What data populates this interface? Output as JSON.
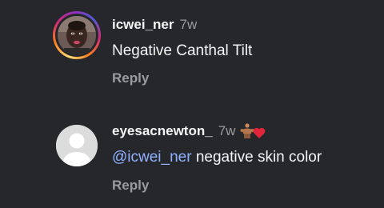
{
  "comments": [
    {
      "username": "icwei_ner",
      "timestamp": "7w",
      "text": "Negative Canthal Tilt",
      "reply_label": "Reply",
      "has_story_ring": true
    },
    {
      "username": "eyesacnewton_",
      "timestamp": "7w",
      "badge_icon": "muscle-heart-emoji-icon",
      "mention": "@icwei_ner",
      "text": "negative skin color",
      "reply_label": "Reply"
    }
  ],
  "colors": {
    "background": "#26272b",
    "primary_text": "#f5f5f5",
    "secondary_text": "#9a9aa0",
    "mention": "#8fb0ff"
  }
}
